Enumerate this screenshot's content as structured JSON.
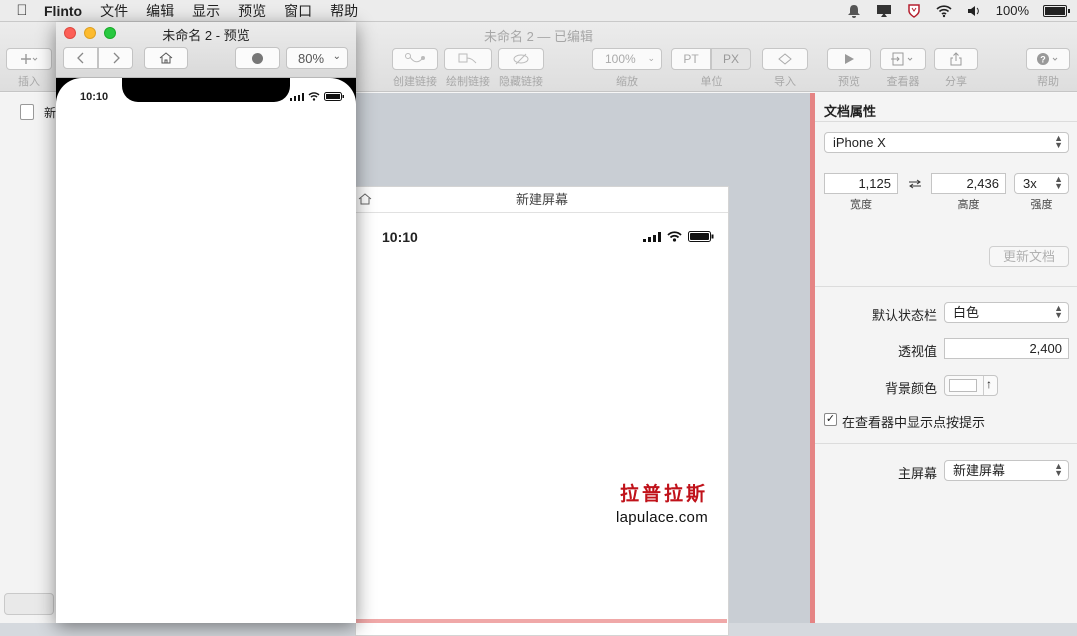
{
  "menubar": {
    "app": "Flinto",
    "items": [
      "文件",
      "编辑",
      "显示",
      "预览",
      "窗口",
      "帮助"
    ],
    "battery": "100%"
  },
  "main_window": {
    "title": "未命名 2 — 已编辑",
    "toolbar": {
      "insert": "插入",
      "create_link": "创建链接",
      "draw_link": "绘制链接",
      "hide_link": "隐藏链接",
      "zoom_value": "100%",
      "zoom": "缩放",
      "unit_pt": "PT",
      "unit_px": "PX",
      "unit": "单位",
      "import": "导入",
      "preview": "预览",
      "viewer": "查看器",
      "share": "分享",
      "help": "帮助"
    },
    "sidebar": {
      "item": "新"
    },
    "artboard": {
      "name": "新建屏幕",
      "time": "10:10",
      "watermark_cn": "拉普拉斯",
      "watermark_en": "lapulace.com"
    }
  },
  "inspector": {
    "title": "文档属性",
    "device": "iPhone X",
    "width_value": "1,125",
    "width_label": "宽度",
    "height_value": "2,436",
    "height_label": "高度",
    "scale_value": "3x",
    "scale_label": "强度",
    "update_button": "更新文档",
    "status_bar_label": "默认状态栏",
    "status_bar_value": "白色",
    "perspective_label": "透视值",
    "perspective_value": "2,400",
    "bg_color_label": "背景颜色",
    "show_hints_label": "在查看器中显示点按提示",
    "show_hints_checked": true,
    "main_screen_label": "主屏幕",
    "main_screen_value": "新建屏幕"
  },
  "preview_window": {
    "title": "未命名 2 - 预览",
    "zoom": "80%",
    "time": "10:10"
  },
  "colors": {
    "accent_red": "#e58484",
    "watermark_red": "#c0121a"
  }
}
